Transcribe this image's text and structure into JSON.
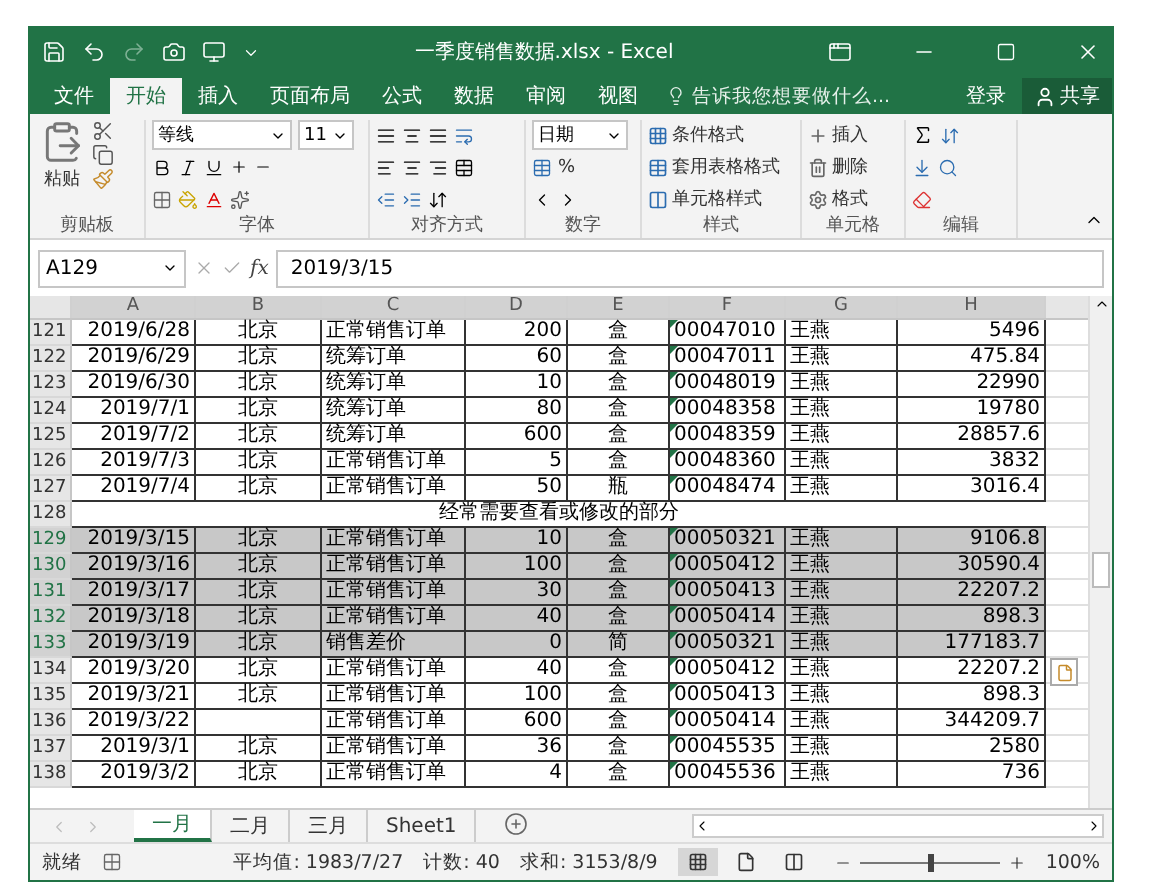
{
  "window": {
    "title": "一季度销售数据.xlsx - Excel"
  },
  "tabs": [
    {
      "label": "文件",
      "selected": false
    },
    {
      "label": "开始",
      "selected": true
    },
    {
      "label": "插入",
      "selected": false
    },
    {
      "label": "页面布局",
      "selected": false
    },
    {
      "label": "公式",
      "selected": false
    },
    {
      "label": "数据",
      "selected": false
    },
    {
      "label": "审阅",
      "selected": false
    },
    {
      "label": "视图",
      "selected": false
    }
  ],
  "tell_me": {
    "placeholder": "告诉我您想要做什么..."
  },
  "account": {
    "sign_in": "登录",
    "share": "共享"
  },
  "ribbon": {
    "paste": "粘贴",
    "font_name": "等线",
    "font_size": "11",
    "number_format": "日期",
    "percent": "%",
    "styles": [
      "条件格式",
      "套用表格格式",
      "单元格样式"
    ],
    "cells": [
      "插入",
      "删除",
      "格式"
    ],
    "groups": [
      "剪贴板",
      "字体",
      "对齐方式",
      "数字",
      "样式",
      "单元格",
      "编辑"
    ]
  },
  "formula_bar": {
    "name_box": "A129",
    "fx": "fx",
    "value": "2019/3/15"
  },
  "columns": [
    "A",
    "B",
    "C",
    "D",
    "E",
    "F",
    "G",
    "H"
  ],
  "rows": [
    {
      "number": "121",
      "kind": "data",
      "selected": false,
      "cells": [
        "2019/6/28",
        "北京",
        "正常销售订单",
        "200",
        "盒",
        "00047010",
        "王燕",
        "5496"
      ]
    },
    {
      "number": "122",
      "kind": "data",
      "selected": false,
      "cells": [
        "2019/6/29",
        "北京",
        "统筹订单",
        "60",
        "盒",
        "00047011",
        "王燕",
        "475.84"
      ]
    },
    {
      "number": "123",
      "kind": "data",
      "selected": false,
      "cells": [
        "2019/6/30",
        "北京",
        "统筹订单",
        "10",
        "盒",
        "00048019",
        "王燕",
        "22990"
      ]
    },
    {
      "number": "124",
      "kind": "data",
      "selected": false,
      "cells": [
        "2019/7/1",
        "北京",
        "统筹订单",
        "80",
        "盒",
        "00048358",
        "王燕",
        "19780"
      ]
    },
    {
      "number": "125",
      "kind": "data",
      "selected": false,
      "cells": [
        "2019/7/2",
        "北京",
        "统筹订单",
        "600",
        "盒",
        "00048359",
        "王燕",
        "28857.6"
      ]
    },
    {
      "number": "126",
      "kind": "data",
      "selected": false,
      "cells": [
        "2019/7/3",
        "北京",
        "正常销售订单",
        "5",
        "盒",
        "00048360",
        "王燕",
        "3832"
      ]
    },
    {
      "number": "127",
      "kind": "data",
      "selected": false,
      "cells": [
        "2019/7/4",
        "北京",
        "正常销售订单",
        "50",
        "瓶",
        "00048474",
        "王燕",
        "3016.4"
      ]
    },
    {
      "number": "128",
      "kind": "note",
      "selected": false,
      "text": "经常需要查看或修改的部分"
    },
    {
      "number": "129",
      "kind": "data",
      "selected": true,
      "cells": [
        "2019/3/15",
        "北京",
        "正常销售订单",
        "10",
        "盒",
        "00050321",
        "王燕",
        "9106.8"
      ]
    },
    {
      "number": "130",
      "kind": "data",
      "selected": true,
      "cells": [
        "2019/3/16",
        "北京",
        "正常销售订单",
        "100",
        "盒",
        "00050412",
        "王燕",
        "30590.4"
      ]
    },
    {
      "number": "131",
      "kind": "data",
      "selected": true,
      "cells": [
        "2019/3/17",
        "北京",
        "正常销售订单",
        "30",
        "盒",
        "00050413",
        "王燕",
        "22207.2"
      ]
    },
    {
      "number": "132",
      "kind": "data",
      "selected": true,
      "cells": [
        "2019/3/18",
        "北京",
        "正常销售订单",
        "40",
        "盒",
        "00050414",
        "王燕",
        "898.3"
      ]
    },
    {
      "number": "133",
      "kind": "data",
      "selected": true,
      "cells": [
        "2019/3/19",
        "北京",
        "销售差价",
        "0",
        "简",
        "00050321",
        "王燕",
        "177183.7"
      ]
    },
    {
      "number": "134",
      "kind": "data",
      "selected": false,
      "cells": [
        "2019/3/20",
        "北京",
        "正常销售订单",
        "40",
        "盒",
        "00050412",
        "王燕",
        "22207.2"
      ]
    },
    {
      "number": "135",
      "kind": "data",
      "selected": false,
      "cells": [
        "2019/3/21",
        "北京",
        "正常销售订单",
        "100",
        "盒",
        "00050413",
        "王燕",
        "898.3"
      ]
    },
    {
      "number": "136",
      "kind": "data",
      "selected": false,
      "cells": [
        "2019/3/22",
        "",
        "正常销售订单",
        "600",
        "盒",
        "00050414",
        "王燕",
        "344209.7"
      ]
    },
    {
      "number": "137",
      "kind": "data",
      "selected": false,
      "cells": [
        "2019/3/1",
        "北京",
        "正常销售订单",
        "36",
        "盒",
        "00045535",
        "王燕",
        "2580"
      ]
    },
    {
      "number": "138",
      "kind": "data",
      "selected": false,
      "cells": [
        "2019/3/2",
        "北京",
        "正常销售订单",
        "4",
        "盒",
        "00045536",
        "王燕",
        "736"
      ]
    }
  ],
  "sheet_tabs": [
    {
      "label": "一月",
      "selected": true
    },
    {
      "label": "二月",
      "selected": false
    },
    {
      "label": "三月",
      "selected": false
    },
    {
      "label": "Sheet1",
      "selected": false
    }
  ],
  "status_bar": {
    "mode": "就绪",
    "average": "平均值: 1983/7/27",
    "count": "计数: 40",
    "sum": "求和: 3153/8/9",
    "zoom": "100%",
    "zoom_slider": {
      "level": 0.5
    }
  }
}
